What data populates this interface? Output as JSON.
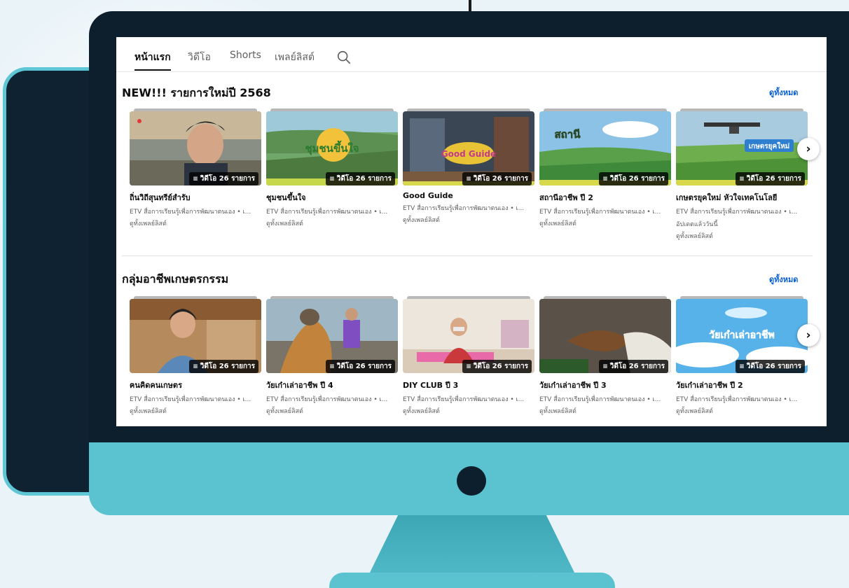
{
  "tabs": [
    {
      "label": "หน้าแรก"
    },
    {
      "label": "วิดีโอ"
    },
    {
      "label": "Shorts"
    },
    {
      "label": "เพลย์ลิสต์"
    }
  ],
  "sections": [
    {
      "title": "NEW!!! รายการใหม่ปี 2568",
      "see_all": "ดูทั้งหมด",
      "cards": [
        {
          "title": "ถิ่นวิถีสุนทรีย์สำรับ",
          "badge": "วิดีโอ 26 รายการ",
          "meta": "ETV สื่อการเรียนรู้เพื่อการพัฒนาตนเอง • เ...",
          "extra": "",
          "link": "ดูทั้งเพลย์ลิสต์",
          "thumb_title": ""
        },
        {
          "title": "ชุมชนขึ้นใจ",
          "badge": "วิดีโอ 26 รายการ",
          "meta": "ETV สื่อการเรียนรู้เพื่อการพัฒนาตนเอง • เ...",
          "extra": "",
          "link": "ดูทั้งเพลย์ลิสต์",
          "thumb_title": "ชุมชนขึ้นใจ"
        },
        {
          "title": "Good Guide",
          "badge": "วิดีโอ 26 รายการ",
          "meta": "ETV สื่อการเรียนรู้เพื่อการพัฒนาตนเอง • เ...",
          "extra": "",
          "link": "ดูทั้งเพลย์ลิสต์",
          "thumb_title": "Good Guide"
        },
        {
          "title": "สถานีอาชีพ ปี 2",
          "badge": "วิดีโอ 26 รายการ",
          "meta": "ETV สื่อการเรียนรู้เพื่อการพัฒนาตนเอง • เ...",
          "extra": "",
          "link": "ดูทั้งเพลย์ลิสต์",
          "thumb_title": "สถานี"
        },
        {
          "title": "เกษตรยุคใหม่ หัวใจเทคโนโลยี",
          "badge": "วิดีโอ 26 รายการ",
          "meta": "ETV สื่อการเรียนรู้เพื่อการพัฒนาตนเอง • เ...",
          "extra": "อัปเดตแล้ววันนี้",
          "link": "ดูทั้งเพลย์ลิสต์",
          "thumb_title": "เกษตรยุคใหม่"
        }
      ]
    },
    {
      "title": "กลุ่มอาชีพเกษตรกรรม",
      "see_all": "ดูทั้งหมด",
      "cards": [
        {
          "title": "ฅนคิดคนเกษตร",
          "badge": "วิดีโอ 26 รายการ",
          "meta": "ETV สื่อการเรียนรู้เพื่อการพัฒนาตนเอง • เ...",
          "extra": "",
          "link": "ดูทั้งเพลย์ลิสต์",
          "thumb_title": ""
        },
        {
          "title": "วัยเก๋าเล่าอาชีพ ปี 4",
          "badge": "วิดีโอ 26 รายการ",
          "meta": "ETV สื่อการเรียนรู้เพื่อการพัฒนาตนเอง • เ...",
          "extra": "",
          "link": "ดูทั้งเพลย์ลิสต์",
          "thumb_title": ""
        },
        {
          "title": "DIY CLUB ปี 3",
          "badge": "วิดีโอ 26 รายการ",
          "meta": "ETV สื่อการเรียนรู้เพื่อการพัฒนาตนเอง • เ...",
          "extra": "",
          "link": "ดูทั้งเพลย์ลิสต์",
          "thumb_title": ""
        },
        {
          "title": "วัยเก๋าเล่าอาชีพ ปี 3",
          "badge": "วิดีโอ 26 รายการ",
          "meta": "ETV สื่อการเรียนรู้เพื่อการพัฒนาตนเอง • เ...",
          "extra": "",
          "link": "ดูทั้งเพลย์ลิสต์",
          "thumb_title": ""
        },
        {
          "title": "วัยเก๋าเล่าอาชีพ ปี 2",
          "badge": "วิดีโอ 26 รายการ",
          "meta": "ETV สื่อการเรียนรู้เพื่อการพัฒนาตนเอง • เ...",
          "extra": "",
          "link": "ดูทั้งเพลย์ลิสต์",
          "thumb_title": "วัยเก๋าเล่าอาชีพ"
        }
      ]
    }
  ],
  "icons": {
    "search": "search-icon",
    "next": "chevron-right-icon",
    "playlist": "playlist-icon"
  },
  "colors": {
    "screen_bg": "#ffffff",
    "monitor_frame": "#0d1f2d",
    "monitor_chin": "#5bc3cf",
    "link_blue": "#065fd4",
    "page_bg": "#e9f3f8"
  }
}
